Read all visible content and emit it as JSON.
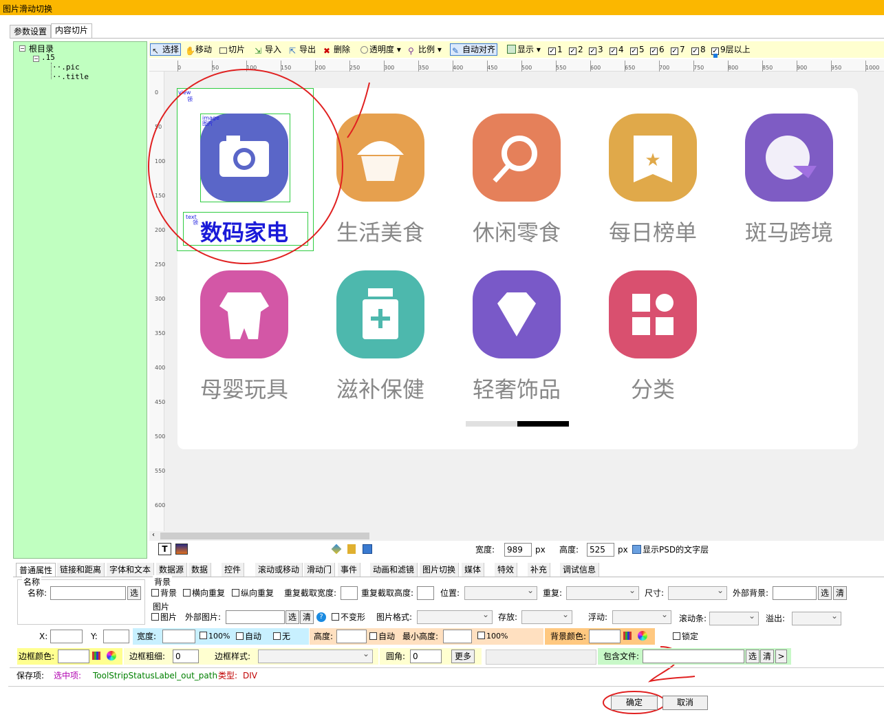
{
  "window": {
    "title": "图片滑动切换"
  },
  "tabs": [
    {
      "label": "参数设置"
    },
    {
      "label": "内容切片"
    }
  ],
  "tree": {
    "root": "根目录",
    "node": ".15",
    "children": [
      ".pic",
      ".title"
    ]
  },
  "toolbar": {
    "select": "选择",
    "move": "移动",
    "slice": "切片",
    "import": "导入",
    "export": "导出",
    "delete": "删除",
    "opacity": "透明度",
    "scale": "比例",
    "auto_align": "自动对齐",
    "show": "显示",
    "layers": [
      "1",
      "2",
      "3",
      "4",
      "5",
      "6",
      "7",
      "8",
      "9层以上"
    ]
  },
  "ruler": {
    "h": [
      "0",
      "50",
      "100",
      "150",
      "200",
      "250",
      "300",
      "350",
      "400",
      "450",
      "500",
      "550",
      "600",
      "650",
      "700",
      "750",
      "800",
      "850",
      "900",
      "950",
      "1000"
    ],
    "v": [
      "0",
      "50",
      "100",
      "150",
      "200",
      "250",
      "300",
      "350",
      "400",
      "450",
      "500",
      "550",
      "600"
    ]
  },
  "canvas": {
    "tiles": [
      {
        "label": "数码家电",
        "color": "#5a66c8",
        "icon": "camera-icon"
      },
      {
        "label": "生活美食",
        "color": "#e6a04e",
        "icon": "cupcake-icon"
      },
      {
        "label": "休闲零食",
        "color": "#e5805a",
        "icon": "lollipop-icon"
      },
      {
        "label": "每日榜单",
        "color": "#e0a94a",
        "icon": "ribbon-star-icon"
      },
      {
        "label": "斑马跨境",
        "color": "#7e5cc4",
        "icon": "globe-arrow-icon"
      },
      {
        "label": "母婴玩具",
        "color": "#d357a6",
        "icon": "baby-clothes-icon"
      },
      {
        "label": "滋补保健",
        "color": "#4db8ad",
        "icon": "medicine-bottle-icon"
      },
      {
        "label": "轻奢饰品",
        "color": "#7959c8",
        "icon": "diamond-icon"
      },
      {
        "label": "分类",
        "color": "#d9506f",
        "icon": "category-grid-icon"
      }
    ],
    "selection_tags": {
      "view": "view",
      "view_sub": "领",
      "image": "image",
      "image_sub": "图片",
      "text": "text",
      "text_sub": "领"
    },
    "annotations": {
      "marker_1": "/",
      "marker_2": "2"
    }
  },
  "bottom_tools": {
    "width_label": "宽度:",
    "width_value": "989",
    "width_unit": "px",
    "height_label": "高度:",
    "height_value": "525",
    "height_unit": "px",
    "psd_text": "显示PSD的文字层"
  },
  "prop_tabs": [
    "普通属性",
    "链接和距离",
    "字体和文本",
    "数据源",
    "数据",
    "控件",
    "滚动或移动",
    "滑动门",
    "事件",
    "动画和滤镜",
    "图片切换",
    "媒体",
    "特效",
    "补充",
    "调试信息"
  ],
  "props": {
    "name_group": "名称",
    "name_label": "名称:",
    "choose": "选",
    "bg_group": "背景",
    "bg_check": "背景",
    "repeat_x": "横向重复",
    "repeat_y": "纵向重复",
    "repeat_w": "重复截取宽度:",
    "repeat_h": "重复截取高度:",
    "position": "位置:",
    "repeat": "重复:",
    "size": "尺寸:",
    "ext_bg": "外部背景:",
    "clear": "清",
    "img_group": "图片",
    "img_check": "图片",
    "ext_img": "外部图片:",
    "no_deform": "不变形",
    "img_format": "图片格式:",
    "stored": "存放:",
    "float": "浮动:",
    "scrollbar": "滚动条:",
    "overflow": "溢出:",
    "x": "X:",
    "y": "Y:",
    "width": "宽度:",
    "pct100": "100%",
    "auto": "自动",
    "none": "无",
    "height": "高度:",
    "auto2": "自动",
    "min_height": "最小高度:",
    "pct100b": "100%",
    "bg_color": "背景颜色:",
    "lock": "锁定",
    "border_color": "边框颜色:",
    "border_width": "边框粗细:",
    "border_width_val": "0",
    "border_style": "边框样式:",
    "radius": "圆角:",
    "radius_val": "0",
    "more": "更多",
    "include_file": "包含文件:",
    "next": ">"
  },
  "status": {
    "save": "保存项:",
    "selected": "选中项:",
    "path": "ToolStripStatusLabel_out_path",
    "type_label": "类型:",
    "type_value": "DIV"
  },
  "dialog": {
    "ok": "确定",
    "cancel": "取消"
  }
}
